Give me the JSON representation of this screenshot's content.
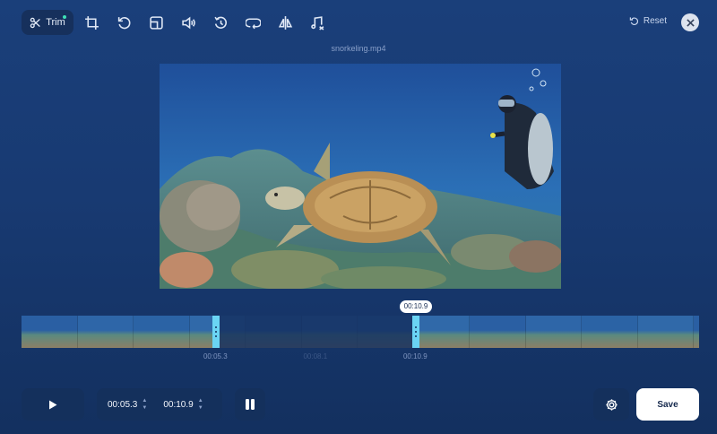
{
  "toolbar": {
    "trim_label": "Trim",
    "tools": [
      "crop-icon",
      "rotate-icon",
      "resize-icon",
      "volume-icon",
      "speed-icon",
      "loop-icon",
      "flip-icon",
      "remove-audio-icon"
    ],
    "reset_label": "Reset"
  },
  "file": {
    "name": "snorkeling.mp4"
  },
  "timeline": {
    "start_tick": "00:05.3",
    "end_tick": "00:10.9",
    "middle_tick": "00:08.1",
    "end_bubble": "00:10.9",
    "start_fraction": 0.287,
    "end_fraction": 0.582
  },
  "controls": {
    "start_time": "00:05.3",
    "end_time": "00:10.9",
    "save_label": "Save"
  },
  "colors": {
    "accent_handle": "#6ad4f4",
    "active_dot": "#3ee0b6",
    "background": "#183a72"
  }
}
